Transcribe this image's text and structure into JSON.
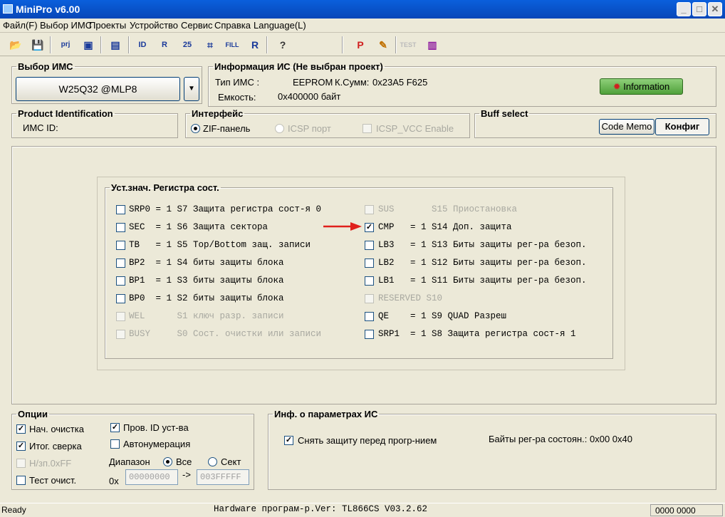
{
  "window": {
    "title": "MiniPro v6.00"
  },
  "menu": [
    "Файл(F)",
    "Выбор ИМС",
    "Проекты",
    "Устройство",
    "Сервис",
    "Справка",
    "Language(L)"
  ],
  "chip_select": {
    "legend": "Выбор ИМС",
    "value": "W25Q32 @MLP8"
  },
  "chip_info": {
    "legend": "Информация ИС (Не выбран проект)",
    "type_label": "Тип ИМС :",
    "type_value": "EEPROM",
    "checksum_label": "К.Сумм:",
    "checksum_value": "0x23A5 F625",
    "capacity_label": "Емкость:",
    "capacity_value": "0x400000 байт",
    "info_button": "Information"
  },
  "product_id": {
    "legend": "Product Identification",
    "label": "ИМС ID:"
  },
  "interface": {
    "legend": "Интерфейс",
    "zif": "ZIF-панель",
    "icsp": "ICSP порт",
    "icsp_vcc": "ICSP_VCC Enable"
  },
  "buff": {
    "legend": "Buff select",
    "code_memo": "Code Memo",
    "config": "Конфиг"
  },
  "register": {
    "legend": "Уст.знач. Регистра сост.",
    "left": [
      {
        "text": "SRP0 = 1 S7 Защита регистра сост-я 0",
        "checked": false,
        "disabled": false
      },
      {
        "text": "SEC  = 1 S6 Защита сектора",
        "checked": false,
        "disabled": false
      },
      {
        "text": "TB   = 1 S5 Top/Bottom защ. записи",
        "checked": false,
        "disabled": false
      },
      {
        "text": "BP2  = 1 S4 биты защиты блока",
        "checked": false,
        "disabled": false
      },
      {
        "text": "BP1  = 1 S3 биты защиты блока",
        "checked": false,
        "disabled": false
      },
      {
        "text": "BP0  = 1 S2 биты защиты блока",
        "checked": false,
        "disabled": false
      },
      {
        "text": "WEL      S1 ключ разр. записи",
        "checked": false,
        "disabled": true
      },
      {
        "text": "BUSY     S0 Сост. очистки или записи",
        "checked": false,
        "disabled": true
      }
    ],
    "right": [
      {
        "text": "SUS       S15 Приостановка",
        "checked": false,
        "disabled": true
      },
      {
        "text": "CMP   = 1 S14 Доп. защита",
        "checked": true,
        "disabled": false
      },
      {
        "text": "LB3   = 1 S13 Биты защиты рег-ра безоп.",
        "checked": false,
        "disabled": false
      },
      {
        "text": "LB2   = 1 S12 Биты защиты рег-ра безоп.",
        "checked": false,
        "disabled": false
      },
      {
        "text": "LB1   = 1 S11 Биты защиты рег-ра безоп.",
        "checked": false,
        "disabled": false
      },
      {
        "text": "RESERVED S10",
        "checked": false,
        "disabled": true
      },
      {
        "text": "QE    = 1 S9 QUAD Разреш",
        "checked": false,
        "disabled": false
      },
      {
        "text": "SRP1  = 1 S8 Защита регистра сост-я 1",
        "checked": false,
        "disabled": false
      }
    ]
  },
  "options": {
    "legend": "Опции",
    "erase": "Нач. очистка",
    "verify": "Итог. сверка",
    "blank": "Н/зп.0xFF",
    "blank_check": "Тест очист.",
    "check_id": "Пров. ID уст-ва",
    "autonum": "Автонумерация",
    "range_label": "Диапазон",
    "range_all": "Все",
    "range_sector": "Сект",
    "hex_prefix": "0x",
    "range_from": "00000000",
    "arrow": "->",
    "range_to": "003FFFFF"
  },
  "params": {
    "legend": "Инф. о параметрах ИС",
    "unprotect": "Снять защиту перед прогр-нием",
    "reg_bytes": "Байты рег-ра состоян.: 0x00 0x40"
  },
  "status": {
    "left": "Ready",
    "center": "Hardware програм-р.Ver: TL866CS V03.2.62",
    "right": "0000 0000"
  },
  "colors": {
    "titlebar": "#0747b8",
    "arrow": "#e0201c",
    "face": "#ece9d8"
  }
}
